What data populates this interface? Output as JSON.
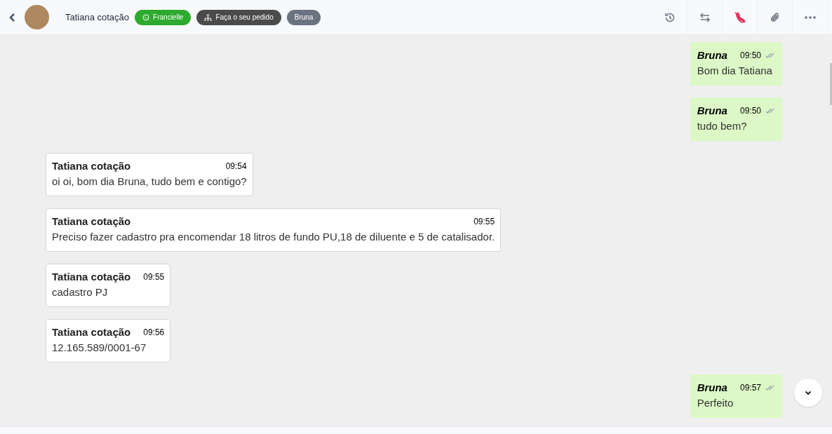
{
  "header": {
    "contact_name": "Tatiana cotação",
    "tags": [
      {
        "kind": "whatsapp",
        "label": "Francielle",
        "color": "#2eaa2e"
      },
      {
        "kind": "flow",
        "label": "Faça o seu pedido",
        "color": "#4b4b4b"
      },
      {
        "kind": "plain",
        "label": "Bruna",
        "color": "#6b7280"
      }
    ]
  },
  "messages": [
    {
      "kind": "outgoing",
      "sender": "Bruna",
      "time": "09:50",
      "text": "Bom dia Tatiana"
    },
    {
      "kind": "outgoing",
      "sender": "Bruna",
      "time": "09:50",
      "text": "tudo bem?"
    },
    {
      "kind": "incoming",
      "sender": "Tatiana cotação",
      "time": "09:54",
      "text": "oi oi, bom dia Bruna, tudo bem e contigo?"
    },
    {
      "kind": "incoming",
      "sender": "Tatiana cotação",
      "time": "09:55",
      "text": "Preciso fazer cadastro pra encomendar 18 litros de fundo PU,18 de diluente e 5 de catalisador."
    },
    {
      "kind": "incoming",
      "sender": "Tatiana cotação",
      "time": "09:55",
      "text": "cadastro PJ"
    },
    {
      "kind": "incoming",
      "sender": "Tatiana cotação",
      "time": "09:56",
      "text": "12.165.589/0001-67"
    },
    {
      "kind": "outgoing",
      "sender": "Bruna",
      "time": "09:57",
      "text": "Perfeito"
    }
  ]
}
